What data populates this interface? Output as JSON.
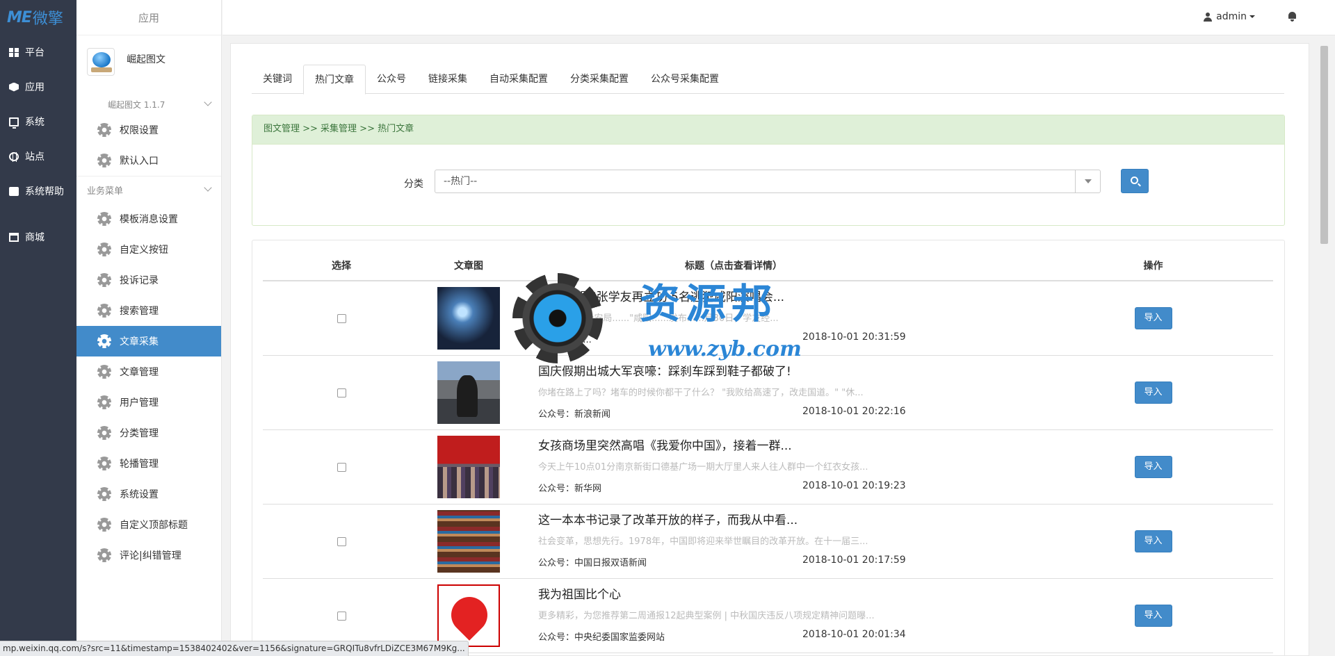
{
  "brand": {
    "logo_latin": "ME",
    "logo_cn": "微擎"
  },
  "main_nav": [
    {
      "label": "平台",
      "icon": "grid-icon"
    },
    {
      "label": "应用",
      "icon": "cube-icon"
    },
    {
      "label": "系统",
      "icon": "monitor-icon"
    },
    {
      "label": "站点",
      "icon": "globe-icon"
    },
    {
      "label": "系统帮助",
      "icon": "help-icon"
    },
    {
      "label": "商城",
      "icon": "store-icon"
    }
  ],
  "sub_nav": {
    "header": "应用",
    "module": {
      "name": "崛起图文",
      "version": "崛起图文 1.1.7"
    },
    "top_items": [
      "权限设置",
      "默认入口"
    ],
    "section_label": "业务菜单",
    "items": [
      "模板消息设置",
      "自定义按钮",
      "投诉记录",
      "搜索管理",
      "文章采集",
      "文章管理",
      "用户管理",
      "分类管理",
      "轮播管理",
      "系统设置",
      "自定义顶部标题",
      "评论|纠错管理"
    ],
    "active_item": "文章采集"
  },
  "topbar": {
    "username": "admin"
  },
  "tabs": [
    "关键词",
    "热门文章",
    "公众号",
    "链接采集",
    "自动采集配置",
    "分类采集配置",
    "公众号采集配置"
  ],
  "active_tab": "热门文章",
  "breadcrumb": "图文管理 >> 采集管理 >> 热门文章",
  "filter": {
    "label": "分类",
    "selected": "--热门--"
  },
  "table": {
    "headers": {
      "select": "选择",
      "image": "文章图",
      "title": "标题（点击查看详情）",
      "action": "操作"
    },
    "import_label": "导入",
    "rows": [
      {
        "title": "\"逃犯克星\"张学友再立功 5名逃犯咸阳演唱会...",
        "desc": "今年1......5公安局......\"咸阳......发布......月30日，学友经...",
        "publisher": "公众号：......",
        "time": "2018-10-01 20:31:59"
      },
      {
        "title": "国庆假期出城大军哀嚎：踩刹车踩到鞋子都破了!",
        "desc": "你堵在路上了吗？堵车的时候你都干了什么？ \"我败给高速了，改走国道。\" \"休...",
        "publisher": "公众号：新浪新闻",
        "time": "2018-10-01 20:22:16"
      },
      {
        "title": "女孩商场里突然高唱《我爱你中国》，接着一群...",
        "desc": "今天上午10点01分南京新街口德基广场一期大厅里人来人往人群中一个红衣女孩...",
        "publisher": "公众号：新华网",
        "time": "2018-10-01 20:19:23"
      },
      {
        "title": "这一本本书记录了改革开放的样子，而我从中看...",
        "desc": "社会变革，思想先行。1978年，中国即将迎来举世瞩目的改革开放。在十一届三...",
        "publisher": "公众号：中国日报双语新闻",
        "time": "2018-10-01 20:17:59"
      },
      {
        "title": "我为祖国比个心",
        "desc": "更多精彩，为您推荐第二周通报12起典型案例 | 中秋国庆违反八项规定精神问题曝...",
        "publisher": "公众号：中央纪委国家监委网站",
        "time": "2018-10-01 20:01:34"
      }
    ]
  },
  "watermark": {
    "cn": "资源邦",
    "url": "www.zyb.com"
  },
  "status_url": "mp.weixin.qq.com/s?src=11&timestamp=1538402402&ver=1156&signature=GRQITu8vfrLDiZCE3M67M9Kg..."
}
